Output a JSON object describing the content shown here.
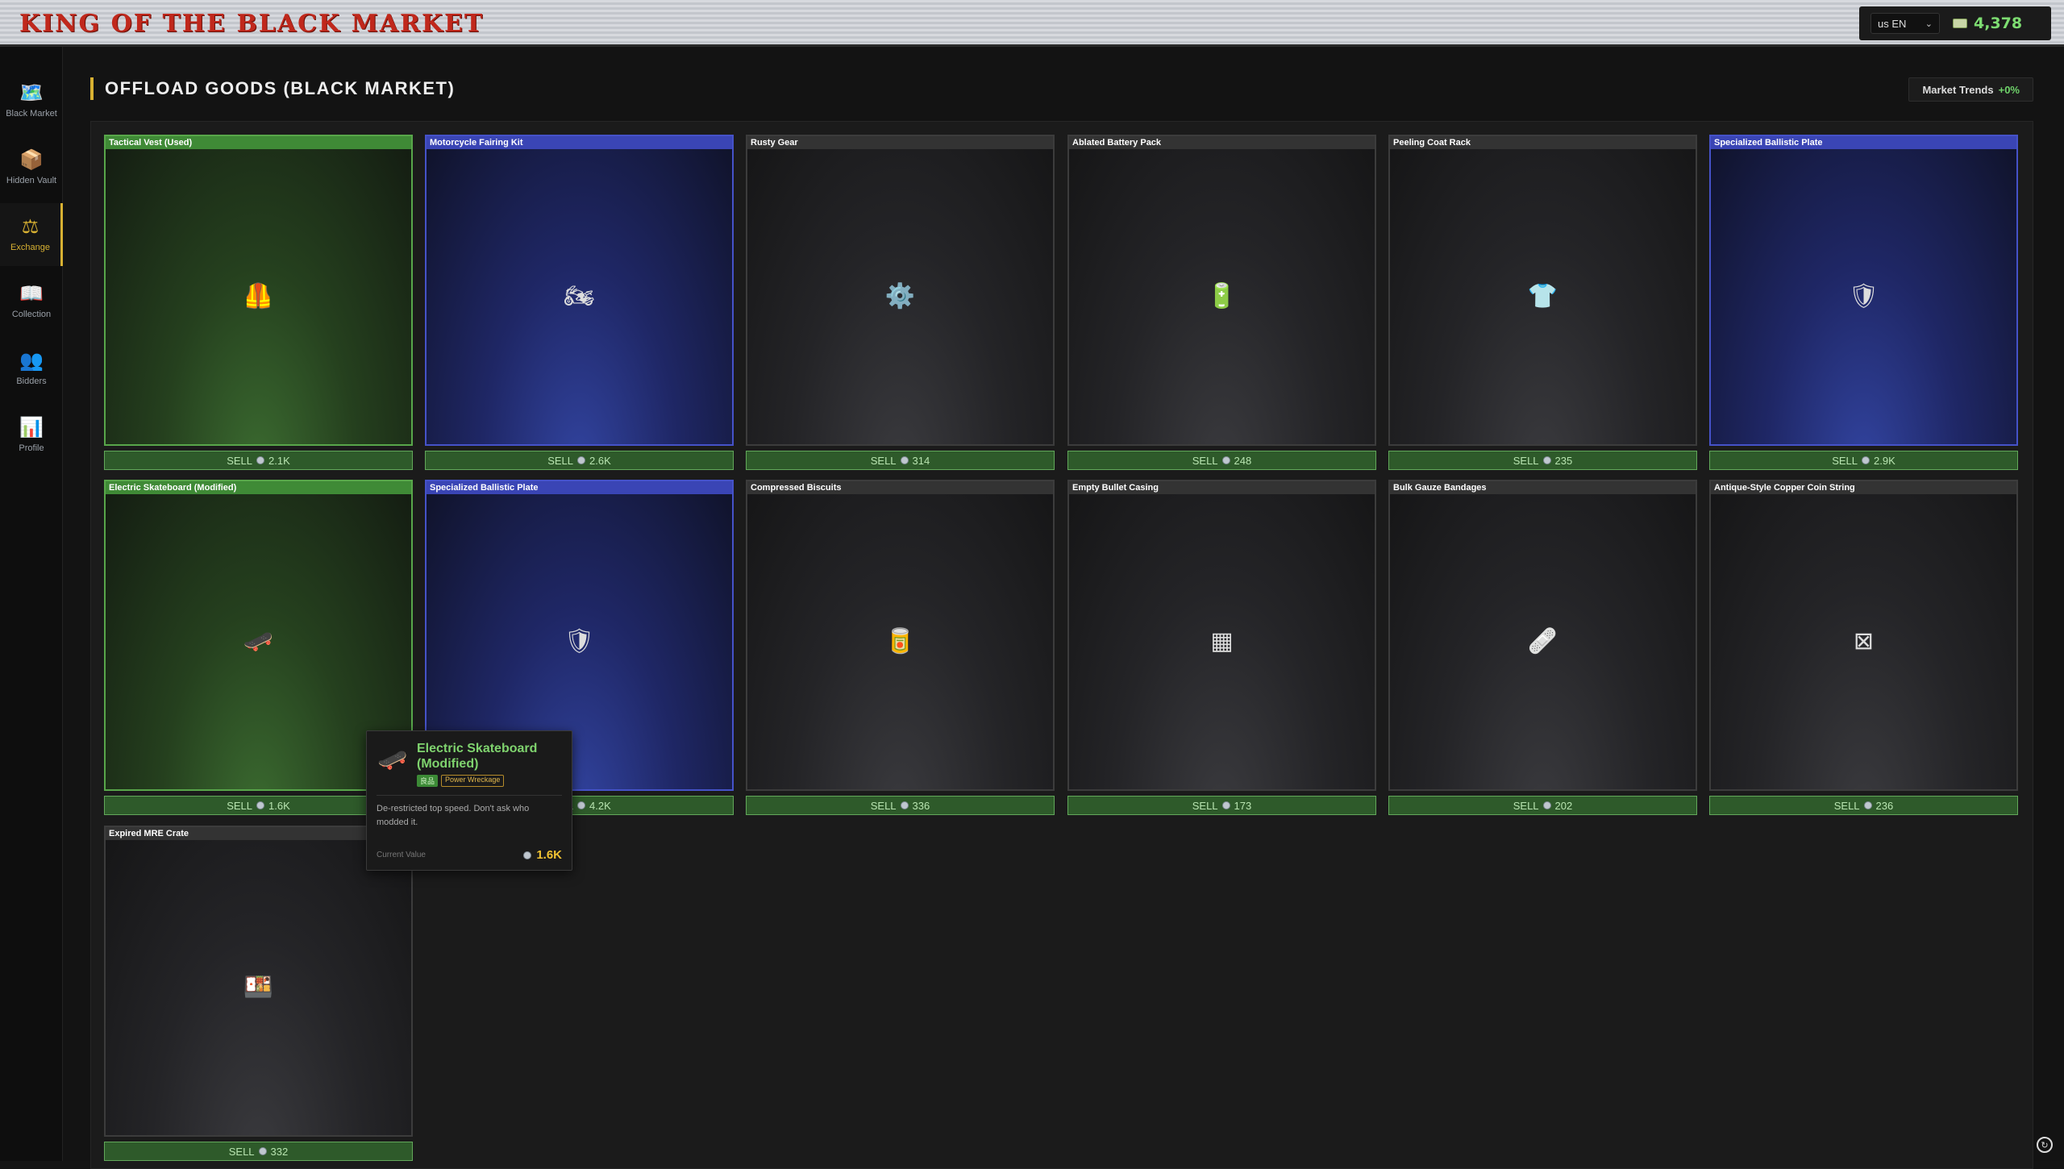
{
  "app": {
    "title": "KING OF THE BLACK MARKET"
  },
  "header": {
    "language": "us EN",
    "money": "4,378"
  },
  "sidebar": {
    "items": [
      {
        "label": "Black Market",
        "icon": "map-icon"
      },
      {
        "label": "Hidden Vault",
        "icon": "box-icon"
      },
      {
        "label": "Exchange",
        "icon": "scales-icon"
      },
      {
        "label": "Collection",
        "icon": "book-icon"
      },
      {
        "label": "Bidders",
        "icon": "people-icon"
      },
      {
        "label": "Profile",
        "icon": "chart-icon"
      }
    ]
  },
  "page": {
    "title": "OFFLOAD GOODS (BLACK MARKET)",
    "trends_label": "Market Trends",
    "trends_value": "+0%",
    "sell_label": "SELL"
  },
  "items": [
    {
      "name": "Tactical Vest (Used)",
      "price": "2.1K",
      "rarity": "green",
      "icon": "🦺",
      "icon_name": "vest-icon"
    },
    {
      "name": "Motorcycle Fairing Kit",
      "price": "2.6K",
      "rarity": "blue",
      "icon": "🏍",
      "icon_name": "motorcycle-icon"
    },
    {
      "name": "Rusty Gear",
      "price": "314",
      "rarity": "gray",
      "icon": "⚙️",
      "icon_name": "gear-icon"
    },
    {
      "name": "Ablated Battery Pack",
      "price": "248",
      "rarity": "gray",
      "icon": "🔋",
      "icon_name": "battery-icon"
    },
    {
      "name": "Peeling Coat Rack",
      "price": "235",
      "rarity": "gray",
      "icon": "👕",
      "icon_name": "shirt-icon"
    },
    {
      "name": "Specialized Ballistic Plate",
      "price": "2.9K",
      "rarity": "blue",
      "icon": "🛡",
      "icon_name": "shield-icon"
    },
    {
      "name": "Electric Skateboard (Modified)",
      "price": "1.6K",
      "rarity": "green",
      "icon": "🛹",
      "icon_name": "skateboard-icon"
    },
    {
      "name": "Specialized Ballistic Plate",
      "price": "4.2K",
      "rarity": "blue",
      "icon": "🛡",
      "icon_name": "shield-icon"
    },
    {
      "name": "Compressed Biscuits",
      "price": "336",
      "rarity": "gray",
      "icon": "🥫",
      "icon_name": "can-icon"
    },
    {
      "name": "Empty Bullet Casing",
      "price": "173",
      "rarity": "gray",
      "icon": "▦",
      "icon_name": "ammo-box-icon"
    },
    {
      "name": "Bulk Gauze Bandages",
      "price": "202",
      "rarity": "gray",
      "icon": "🩹",
      "icon_name": "bandage-icon"
    },
    {
      "name": "Antique-Style Copper Coin String",
      "price": "236",
      "rarity": "gray",
      "icon": "⊠",
      "icon_name": "missing-image-icon"
    },
    {
      "name": "Expired MRE Crate",
      "price": "332",
      "rarity": "gray",
      "icon": "🍱",
      "icon_name": "food-crate-icon"
    }
  ],
  "tooltip": {
    "name": "Electric Skateboard (Modified)",
    "rarity_tag": "良品",
    "category_tag": "Power Wreckage",
    "description": "De-restricted top speed. Don't ask who modded it.",
    "value_label": "Current Value",
    "value": "1.6K",
    "icon": "🛹"
  }
}
